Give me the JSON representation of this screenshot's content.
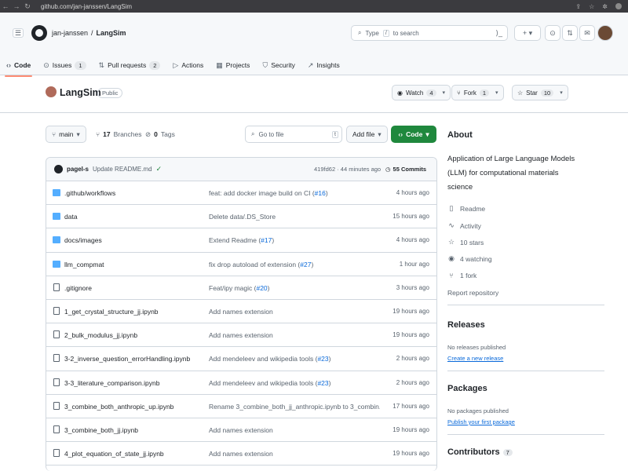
{
  "browser": {
    "url": "github.com/jan-janssen/LangSim"
  },
  "header": {
    "owner": "jan-janssen",
    "separator": "/",
    "repo": "LangSim",
    "search_prefix": "Type",
    "search_key": "/",
    "search_suffix": "to search",
    "plus": "+ ▾"
  },
  "tabs": [
    {
      "icon": "‹›",
      "label": "Code",
      "count": ""
    },
    {
      "icon": "⊙",
      "label": "Issues",
      "count": "1"
    },
    {
      "icon": "⇅",
      "label": "Pull requests",
      "count": "2"
    },
    {
      "icon": "▷",
      "label": "Actions",
      "count": ""
    },
    {
      "icon": "▦",
      "label": "Projects",
      "count": ""
    },
    {
      "icon": "⛉",
      "label": "Security",
      "count": ""
    },
    {
      "icon": "↗",
      "label": "Insights",
      "count": ""
    }
  ],
  "repo": {
    "name": "LangSim",
    "visibility": "Public",
    "watch": {
      "label": "Watch",
      "count": "4"
    },
    "fork": {
      "label": "Fork",
      "count": "1"
    },
    "star": {
      "label": "Star",
      "count": "10"
    }
  },
  "toolbar": {
    "branch": "main",
    "branches": "17",
    "branches_label": "Branches",
    "tags": "0",
    "tags_label": "Tags",
    "go_to_file": "Go to file",
    "go_key": "t",
    "add_file": "Add file",
    "code": "Code"
  },
  "commit": {
    "author": "pagel-s",
    "message": "Update README.md",
    "sha": "419fd62",
    "time": "44 minutes ago",
    "commits": "55 Commits"
  },
  "files": [
    {
      "type": "dir",
      "name": ".github/workflows",
      "msg": "feat: add docker image build on CI (",
      "link": "#16",
      "msg_end": ")",
      "time": "4 hours ago"
    },
    {
      "type": "dir",
      "name": "data",
      "msg": "Delete data/.DS_Store",
      "link": "",
      "msg_end": "",
      "time": "15 hours ago"
    },
    {
      "type": "dir",
      "name": "docs/images",
      "msg": "Extend Readme (",
      "link": "#17",
      "msg_end": ")",
      "time": "4 hours ago"
    },
    {
      "type": "dir",
      "name": "llm_compmat",
      "msg": "fix drop autoload of extension (",
      "link": "#27",
      "msg_end": ")",
      "time": "1 hour ago"
    },
    {
      "type": "file",
      "name": ".gitignore",
      "msg": "Feat/ipy magic (",
      "link": "#20",
      "msg_end": ")",
      "time": "3 hours ago"
    },
    {
      "type": "file",
      "name": "1_get_crystal_structure_jj.ipynb",
      "msg": "Add names extension",
      "link": "",
      "msg_end": "",
      "time": "19 hours ago"
    },
    {
      "type": "file",
      "name": "2_bulk_modulus_jj.ipynb",
      "msg": "Add names extension",
      "link": "",
      "msg_end": "",
      "time": "19 hours ago"
    },
    {
      "type": "file",
      "name": "3-2_inverse_question_errorHandling.ipynb",
      "msg": "Add mendeleev and wikipedia tools (",
      "link": "#23",
      "msg_end": ")",
      "time": "2 hours ago"
    },
    {
      "type": "file",
      "name": "3-3_literature_comparison.ipynb",
      "msg": "Add mendeleev and wikipedia tools (",
      "link": "#23",
      "msg_end": ")",
      "time": "2 hours ago"
    },
    {
      "type": "file",
      "name": "3_combine_both_anthropic_up.ipynb",
      "msg": "Rename 3_combine_both_jj_anthropic.ipynb to 3_combin...",
      "link": "",
      "msg_end": "",
      "time": "17 hours ago"
    },
    {
      "type": "file",
      "name": "3_combine_both_jj.ipynb",
      "msg": "Add names extension",
      "link": "",
      "msg_end": "",
      "time": "19 hours ago"
    },
    {
      "type": "file",
      "name": "4_plot_equation_of_state_jj.ipynb",
      "msg": "Add names extension",
      "link": "",
      "msg_end": "",
      "time": "19 hours ago"
    }
  ],
  "about": {
    "heading": "About",
    "description": "Application of Large Language Models (LLM) for computational materials science",
    "readme": "Readme",
    "activity": "Activity",
    "stars": "10 stars",
    "watching": "4 watching",
    "forks": "1 fork",
    "report": "Report repository"
  },
  "releases": {
    "heading": "Releases",
    "none": "No releases published",
    "create": "Create a new release"
  },
  "packages": {
    "heading": "Packages",
    "none": "No packages published",
    "publish": "Publish your first package"
  },
  "contributors": {
    "heading": "Contributors",
    "count": "7"
  }
}
